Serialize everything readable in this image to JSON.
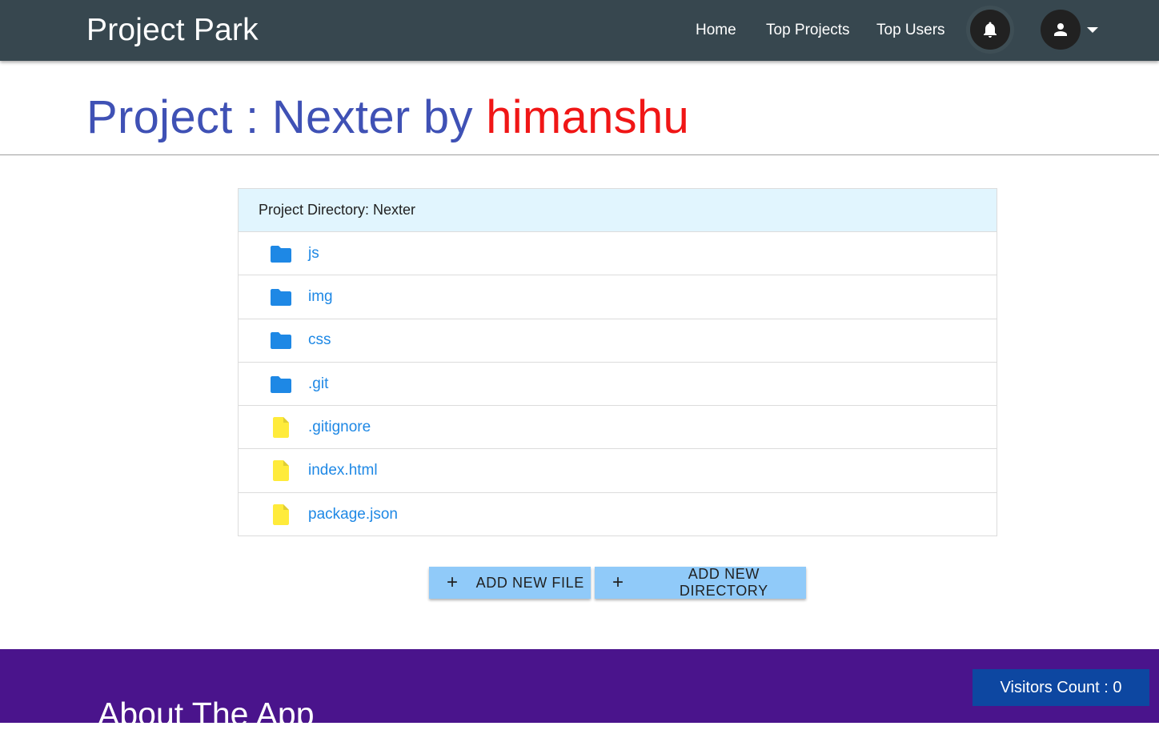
{
  "navbar": {
    "brand": "Project Park",
    "links": [
      {
        "label": "Home"
      },
      {
        "label": "Top Projects"
      },
      {
        "label": "Top Users"
      }
    ],
    "notification_icon": "bell-icon",
    "account_icon": "user-icon",
    "background": "#37474f"
  },
  "page": {
    "title_prefix": "Project : Nexter by",
    "owner": "himanshu",
    "title_color": "#3f51b5",
    "owner_color": "#f01616"
  },
  "directory": {
    "header": "Project Directory: Nexter",
    "items": [
      {
        "name": "js",
        "type": "folder",
        "icon": "folder-icon"
      },
      {
        "name": "img",
        "type": "folder",
        "icon": "folder-icon"
      },
      {
        "name": "css",
        "type": "folder",
        "icon": "folder-icon"
      },
      {
        "name": ".git",
        "type": "folder",
        "icon": "folder-icon"
      },
      {
        "name": ".gitignore",
        "type": "file",
        "icon": "file-icon"
      },
      {
        "name": "index.html",
        "type": "file",
        "icon": "file-icon"
      },
      {
        "name": "package.json",
        "type": "file",
        "icon": "file-icon"
      }
    ],
    "folder_color": "#1e88e5",
    "file_color": "#ffeb3b"
  },
  "actions": {
    "add_file": "ADD NEW FILE",
    "add_directory": "ADD NEW DIRECTORY",
    "button_color": "#90caf9"
  },
  "footer": {
    "about_title": "About The App",
    "visitors": "Visitors Count : 0",
    "background": "#4a148c"
  }
}
